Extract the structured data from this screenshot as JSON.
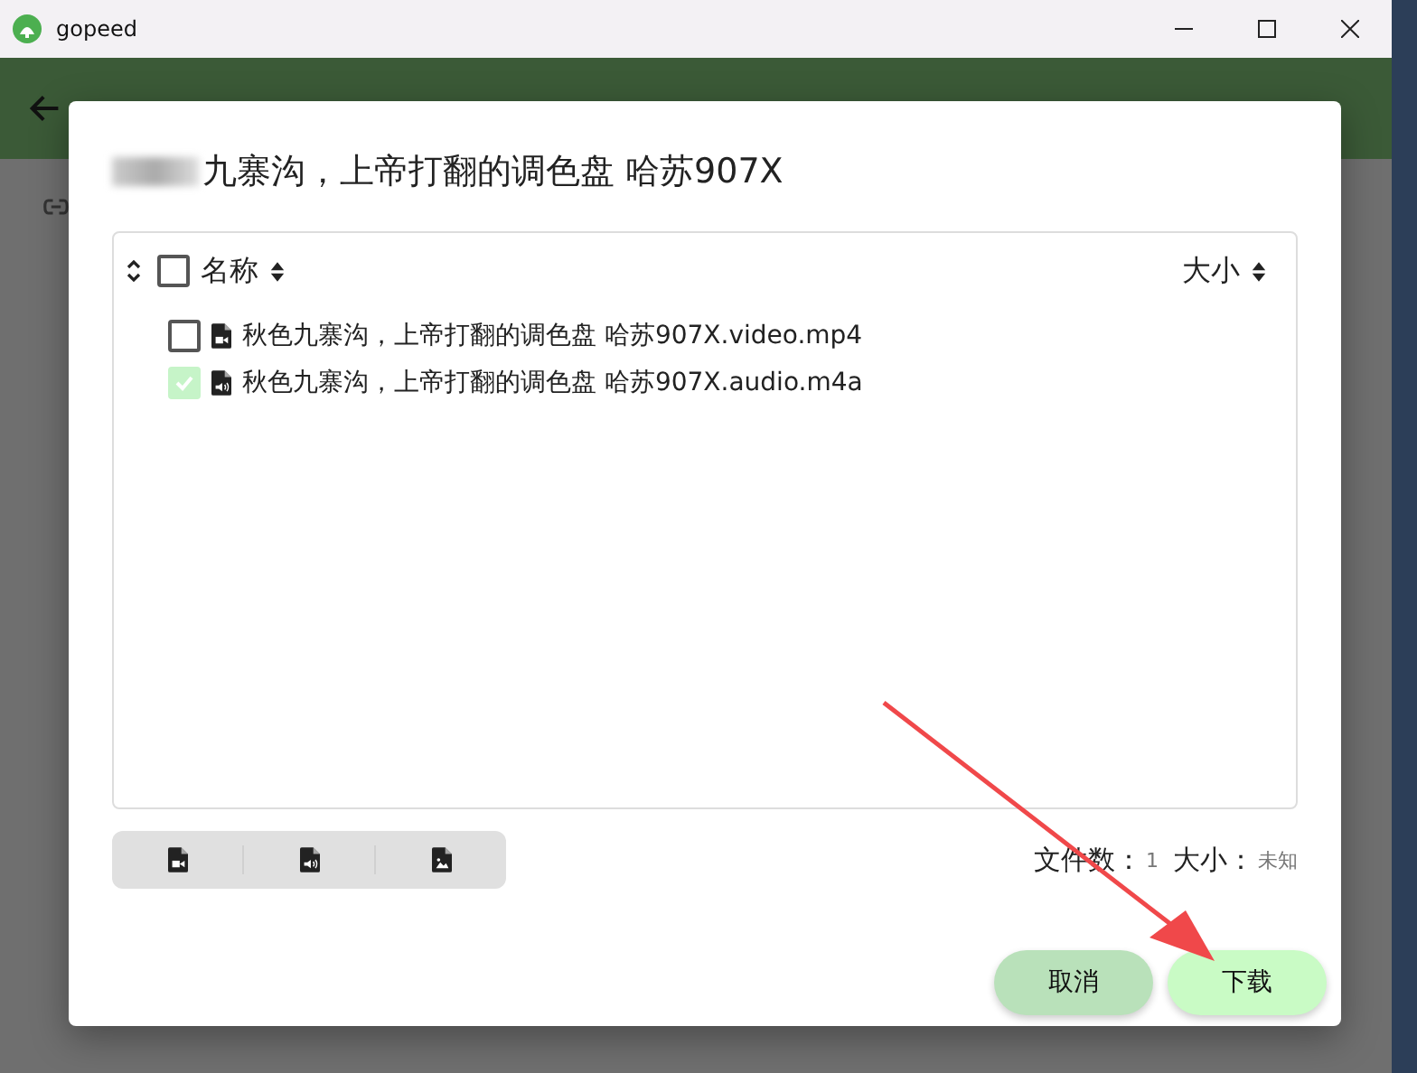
{
  "window": {
    "title": "gopeed"
  },
  "dialog": {
    "title": "九寨沟，上帝打翻的调色盘 哈苏907X",
    "table": {
      "select_all": {
        "checked": false
      },
      "columns": [
        {
          "label": "名称"
        },
        {
          "label": "大小"
        }
      ],
      "rows": [
        {
          "name": "秋色九寨沟，上帝打翻的调色盘 哈苏907X.video.mp4",
          "kind": "video",
          "checked": false
        },
        {
          "name": "秋色九寨沟，上帝打翻的调色盘 哈苏907X.audio.m4a",
          "kind": "audio",
          "checked": true
        }
      ]
    },
    "filters": [
      {
        "kind": "video"
      },
      {
        "kind": "audio"
      },
      {
        "kind": "image"
      }
    ],
    "summary": {
      "count_label": "文件数：",
      "count": "1",
      "size_label": "大小：",
      "size": "未知"
    },
    "buttons": [
      {
        "label": "取消",
        "kind": "cancel"
      },
      {
        "label": "下载",
        "kind": "primary"
      }
    ]
  }
}
